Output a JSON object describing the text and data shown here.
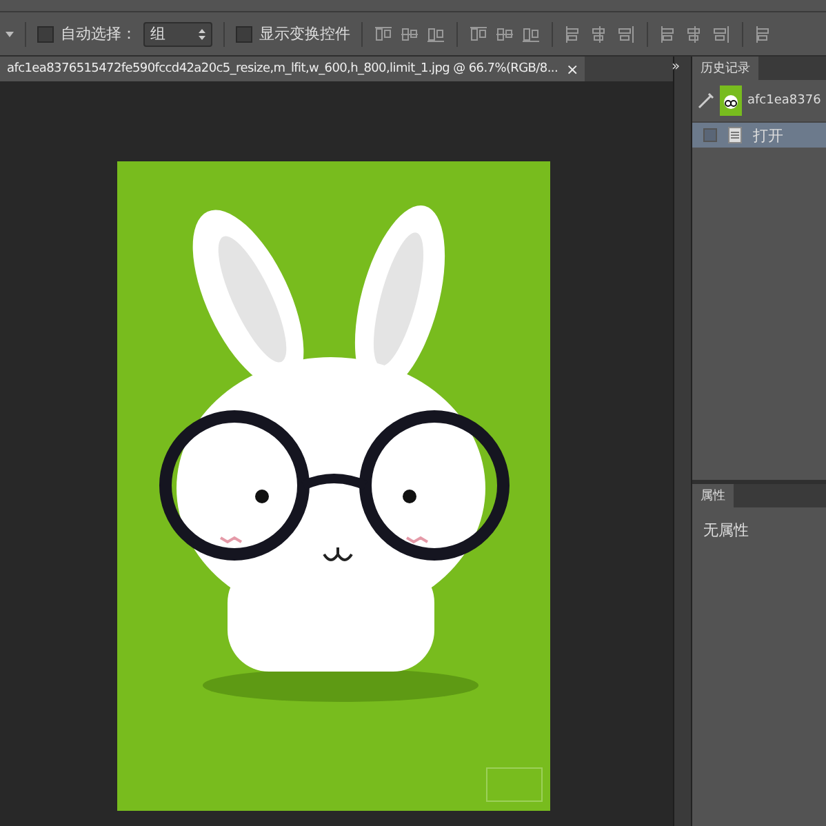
{
  "options_bar": {
    "auto_select": {
      "label": "自动选择：",
      "checked": false
    },
    "auto_select_target": {
      "value": "组"
    },
    "show_transform": {
      "label": "显示变换控件",
      "checked": false
    }
  },
  "document_tab": {
    "title": "afc1ea8376515472fe590fccd42a20c5_resize,m_lfit,w_600,h_800,limit_1.jpg @ 66.7%(RGB/8...",
    "close": "×"
  },
  "panel_collapse": "»",
  "history_panel": {
    "tab": "历史记录",
    "snapshot": "afc1ea8376",
    "items": [
      {
        "label": "打开",
        "selected": true
      }
    ]
  },
  "properties_panel": {
    "tab": "属性",
    "text": "无属性"
  }
}
